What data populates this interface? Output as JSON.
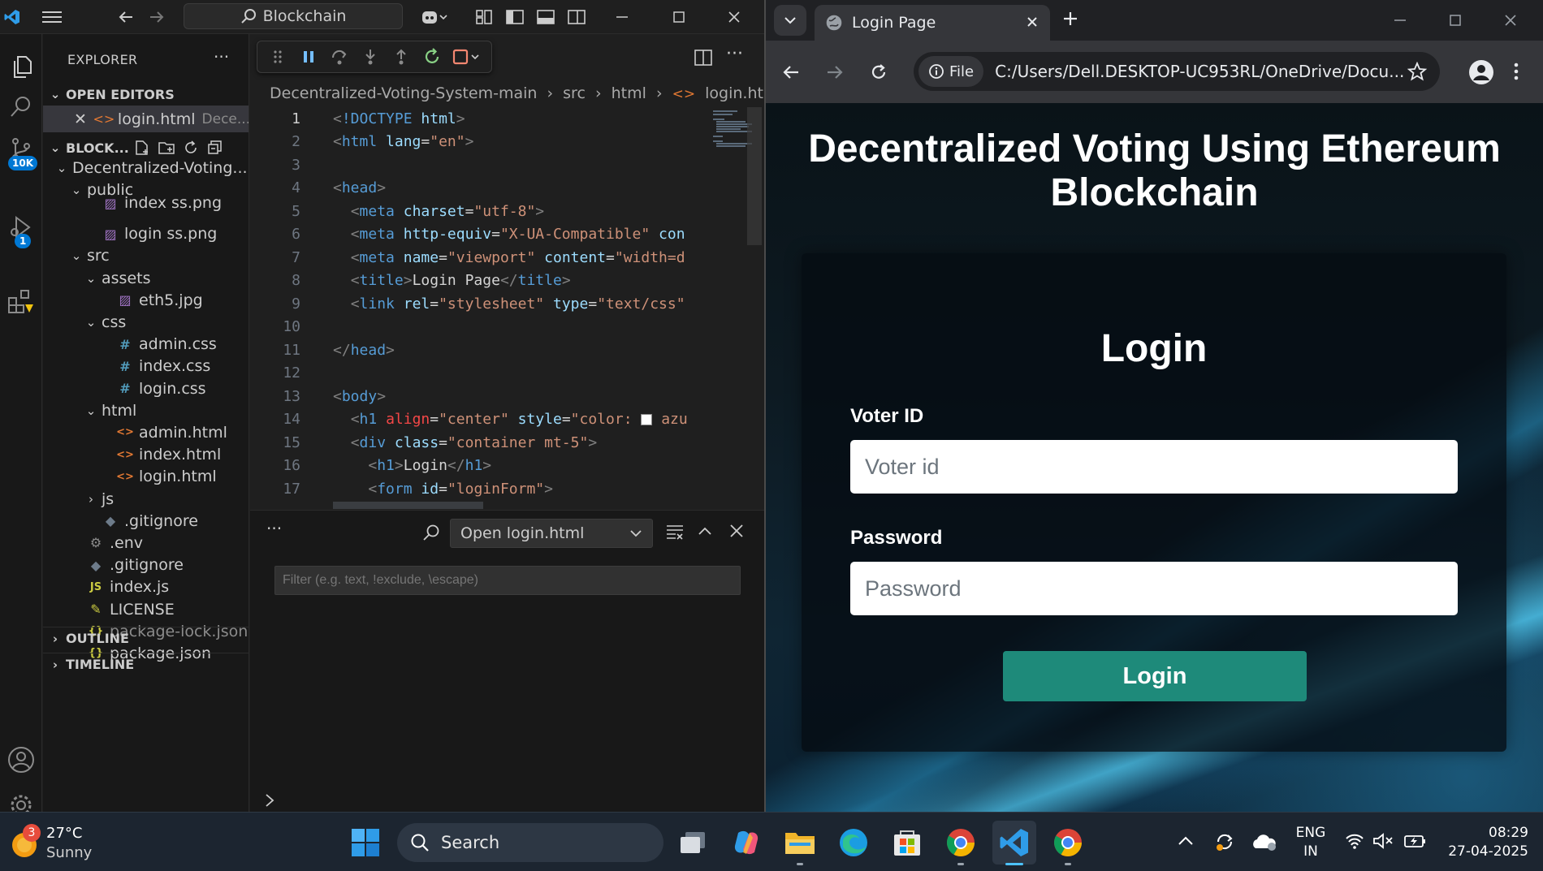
{
  "vscode": {
    "search_title": "Blockchain",
    "sidebar": {
      "header": "EXPLORER",
      "open_editors_label": "OPEN EDITORS",
      "open_editor": {
        "name": "login.html",
        "path": "Dece..."
      },
      "workspace_label": "BLOCK...",
      "tree": [
        {
          "label": "Decentralized-Voting...",
          "kind": "folder",
          "depth": 0
        },
        {
          "label": "public",
          "kind": "folder",
          "depth": 1
        },
        {
          "label": "index ss.png",
          "kind": "image",
          "depth": 2
        },
        {
          "label": "login ss.png",
          "kind": "image",
          "depth": 2
        },
        {
          "label": "src",
          "kind": "folder",
          "depth": 1
        },
        {
          "label": "assets",
          "kind": "folder",
          "depth": 2
        },
        {
          "label": "eth5.jpg",
          "kind": "image",
          "depth": 3
        },
        {
          "label": "css",
          "kind": "folder",
          "depth": 2
        },
        {
          "label": "admin.css",
          "kind": "css",
          "depth": 3
        },
        {
          "label": "index.css",
          "kind": "css",
          "depth": 3
        },
        {
          "label": "login.css",
          "kind": "css",
          "depth": 3
        },
        {
          "label": "html",
          "kind": "folder",
          "depth": 2
        },
        {
          "label": "admin.html",
          "kind": "html",
          "depth": 3
        },
        {
          "label": "index.html",
          "kind": "html",
          "depth": 3
        },
        {
          "label": "login.html",
          "kind": "html",
          "depth": 3
        },
        {
          "label": "js",
          "kind": "folder-closed",
          "depth": 2
        },
        {
          "label": ".gitignore",
          "kind": "git",
          "depth": 2
        },
        {
          "label": ".env",
          "kind": "gear",
          "depth": 1
        },
        {
          "label": ".gitignore",
          "kind": "git",
          "depth": 1
        },
        {
          "label": "index.js",
          "kind": "js",
          "depth": 1
        },
        {
          "label": "LICENSE",
          "kind": "license",
          "depth": 1
        },
        {
          "label": "package-lock.json",
          "kind": "json",
          "depth": 1
        },
        {
          "label": "package.json",
          "kind": "json",
          "depth": 1
        }
      ],
      "outline_label": "OUTLINE",
      "timeline_label": "TIMELINE"
    },
    "badges": {
      "source_control": "10K",
      "run_debug": "1"
    },
    "breadcrumb": [
      "Decentralized-Voting-System-main",
      "src",
      "html",
      "login.html",
      "..."
    ],
    "panel": {
      "select_value": "Open login.html",
      "filter_placeholder": "Filter (e.g. text, !exclude, \\escape)"
    }
  },
  "chrome": {
    "tab_title": "Login Page",
    "address_chip": "File",
    "url": "C:/Users/Dell.DESKTOP-UC953RL/OneDrive/Docu...",
    "page": {
      "title": "Decentralized Voting Using Ethereum Blockchain",
      "card_title": "Login",
      "voter_label": "Voter ID",
      "voter_placeholder": "Voter id",
      "password_label": "Password",
      "password_placeholder": "Password",
      "login_button": "Login"
    }
  },
  "taskbar": {
    "weather_badge": "3",
    "temperature": "27°C",
    "condition": "Sunny",
    "search_label": "Search",
    "lang_top": "ENG",
    "lang_bottom": "IN",
    "time": "08:29",
    "date": "27-04-2025"
  },
  "colors": {
    "login_button": "#1e8a7a",
    "vscode_accent": "#0078d4",
    "debug_warning": "#f1c40f"
  }
}
